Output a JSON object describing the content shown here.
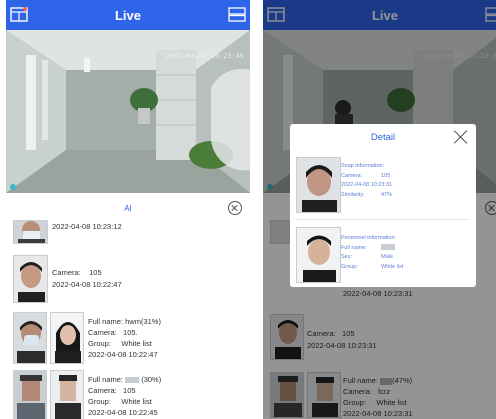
{
  "colors": {
    "accent": "#2e64e8",
    "overlay": "rgba(0,0,0,0.42)"
  },
  "left": {
    "header": {
      "title": "Live",
      "left_icon": "layout-grid-icon",
      "right_icon": "split-screen-icon"
    },
    "video": {
      "timestamp": "2022-04-08 10:23:45"
    },
    "ai_panel": {
      "title": "AI",
      "close_icon": "close-circle-icon"
    },
    "snaps": [
      {
        "time": "2022-04-08 10:23:12"
      },
      {
        "camera_label": "Camera:",
        "camera": "105",
        "time": "2022-04-08 10:22:47"
      },
      {
        "name_label": "Full name:",
        "name": "hwm(31%)",
        "camera_label": "Camera:",
        "camera": "105",
        "group_label": "Group:",
        "group": "White list",
        "time": "2022-04-08 10:22:47"
      },
      {
        "name_label": "Full name:",
        "name_suffix": "(30%)",
        "camera_label": "Camera:",
        "camera": "105",
        "group_label": "Group:",
        "group": "White list",
        "time": "2022-04-08 10:22:45"
      }
    ]
  },
  "right": {
    "header": {
      "title": "Live",
      "left_icon": "layout-grid-icon",
      "right_icon": "split-screen-icon"
    },
    "video": {
      "timestamp": "2022-04-08 10:23:31"
    },
    "detail": {
      "title": "Detail",
      "close_icon": "close-icon",
      "snap": {
        "heading": "Snap information:",
        "camera_label": "Camera:",
        "camera": "105",
        "time": "2022-04-08 10:23:31",
        "similarity_label": "Similarity:",
        "similarity": "47%"
      },
      "personnel": {
        "heading": "Personnel information:",
        "name_label": "Full name:",
        "sex_label": "Sex:",
        "sex": "Male",
        "group_label": "Group:",
        "group": "White list"
      }
    },
    "background_snaps": [
      {
        "time": "2022-04-08 10:23:31"
      },
      {
        "camera_label": "Camera:",
        "camera": "105",
        "time": "2022-04-08 10:23:31"
      },
      {
        "name_label": "Full name:",
        "name_suffix": "(47%)",
        "camera_label": "Camera:",
        "camera": "fcrz",
        "group_label": "Group:",
        "group": "White list",
        "time": "2022-04-08 10:23:31"
      }
    ]
  }
}
